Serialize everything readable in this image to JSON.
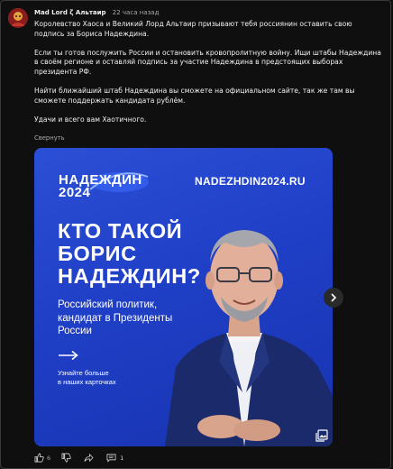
{
  "post": {
    "author": "Mad Lord ζ Альтаир",
    "time": "22 часа назад",
    "paragraphs": [
      "Королевство Хаоса и Великий Лорд Альтаир призывают тебя россиянин оставить свою подпись за Бориса Надеждина.",
      "Если ты готов послужить России и остановить кровопролитную войну. Ищи штабы Надеждина в своём регионе и оставляй подпись за участие Надеждина в предстоящих выборах президента РФ.",
      "Найти ближайший штаб Надеждина вы сможете на официальном сайте, так же там вы сможете поддержать кандидата рублём.",
      "Удачи и всего вам Хаотичного."
    ],
    "collapse_label": "Свернуть"
  },
  "image": {
    "brand_line1": "НАДЕЖДИН",
    "brand_line2": "2024",
    "site": "NADEZHDIN2024.RU",
    "headline": [
      "КТО ТАКОЙ",
      "БОРИС",
      "НАДЕЖДИН?"
    ],
    "subtitle": [
      "Российский политик,",
      "кандидат в Президенты",
      "России"
    ],
    "cta": [
      "Узнайте больше",
      "в наших карточках"
    ],
    "gallery_icon": "gallery-icon"
  },
  "actions": {
    "like_count": "6",
    "comments_count": "1",
    "icons": [
      "thumb-up-icon",
      "thumb-down-icon",
      "share-icon",
      "comment-icon"
    ]
  },
  "colors": {
    "background": "#0f0f0f",
    "image_blue": "#2244d0",
    "text": "#f1f1f1",
    "muted": "#aaaaaa"
  }
}
